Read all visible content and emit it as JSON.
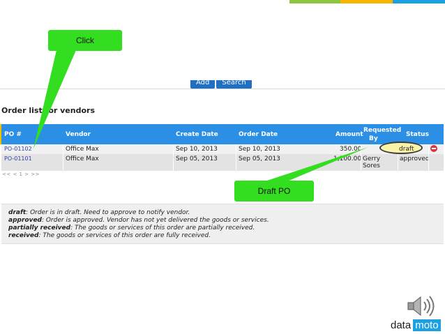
{
  "colors": {
    "accent_green": "#33dd1f",
    "header_blue": "#2b8fe6",
    "link_blue": "#2a43a3"
  },
  "toolbar": {
    "add_label": "Add",
    "search_label": "Search"
  },
  "section_title": "Order list for vendors",
  "table": {
    "headers": {
      "po": "PO #",
      "vendor": "Vendor",
      "create_date": "Create Date",
      "order_date": "Order Date",
      "amount": "Amount",
      "requested_by_1": "Requested",
      "requested_by_2": "By",
      "status": "Status"
    },
    "rows": [
      {
        "po": "PO-01102",
        "vendor": "Office Max",
        "create_date": "Sep 10, 2013",
        "order_date": "Sep 10, 2013",
        "amount": "350.00",
        "requested_by_1": "",
        "requested_by_2": "",
        "status": "draft"
      },
      {
        "po": "PO-01101",
        "vendor": "Office Max",
        "create_date": "Sep 05, 2013",
        "order_date": "Sep 05, 2013",
        "amount": "1,100.00",
        "requested_by_1": "Gerry",
        "requested_by_2": "Sores",
        "status": "approved"
      }
    ]
  },
  "pager": "<< < 1 > >>",
  "legend": [
    {
      "term": "draft",
      "desc": ": Order is in draft. Need to approve to notify vendor."
    },
    {
      "term": "approved",
      "desc": ": Order is approved. Vendor has not yet delivered the goods or services."
    },
    {
      "term": "partially received",
      "desc": ": The goods or services of this order are partially received."
    },
    {
      "term": "received",
      "desc": ": The goods or services of this order are fully received."
    }
  ],
  "callouts": {
    "click": "Click",
    "draft_po": "Draft PO"
  },
  "icons": {
    "delete": "delete-icon",
    "speaker": "speaker-icon"
  },
  "logo": {
    "part1": "data",
    "part2": "moto"
  }
}
